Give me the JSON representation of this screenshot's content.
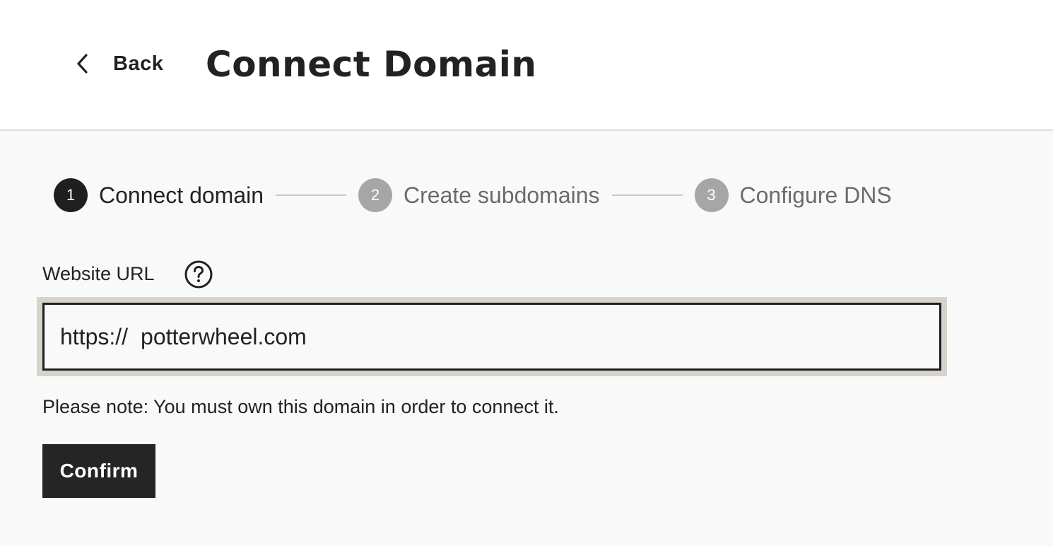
{
  "header": {
    "back_label": "Back",
    "title": "Connect Domain"
  },
  "stepper": {
    "steps": [
      {
        "number": "1",
        "label": "Connect domain",
        "state": "active"
      },
      {
        "number": "2",
        "label": "Create subdomains",
        "state": "inactive"
      },
      {
        "number": "3",
        "label": "Configure DNS",
        "state": "inactive"
      }
    ]
  },
  "form": {
    "field_label": "Website URL",
    "help_icon": "question-circle-icon",
    "url_prefix": "https://",
    "url_value": "potterwheel.com",
    "note": "Please note: You must own this domain in order to connect it.",
    "confirm_label": "Confirm"
  },
  "colors": {
    "primary": "#252525",
    "inactive_step": "#a6a6a6",
    "input_focus_ring": "#d7d3cc",
    "page_background": "#f9f9f9"
  }
}
